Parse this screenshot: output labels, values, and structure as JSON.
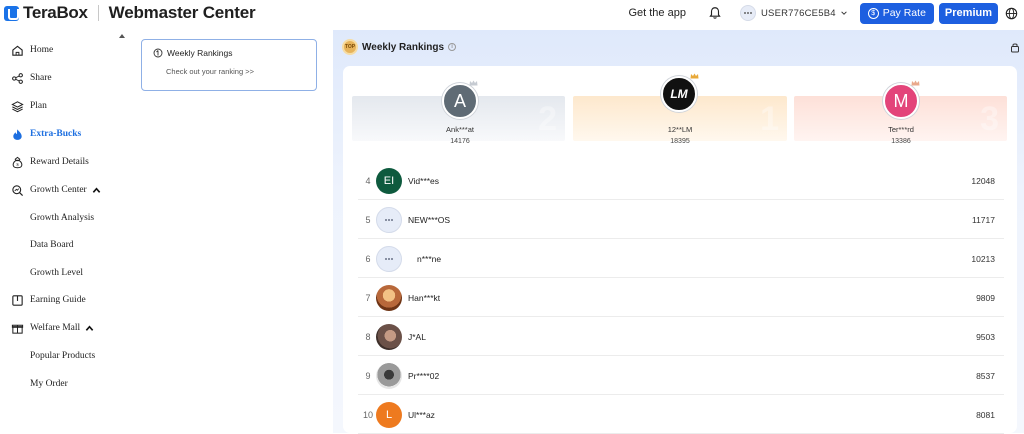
{
  "header": {
    "brand": "TeraBox",
    "title": "Webmaster Center",
    "get_app": "Get the app",
    "user": "USER776CE5B4",
    "pay_rate": "Pay Rate",
    "premium": "Premium"
  },
  "sidebar": {
    "items": [
      {
        "label": "Home",
        "icon": "home-icon"
      },
      {
        "label": "Share",
        "icon": "share-icon"
      },
      {
        "label": "Plan",
        "icon": "layers-icon"
      },
      {
        "label": "Extra-Bucks",
        "icon": "flame-icon",
        "active": true
      },
      {
        "label": "Reward Details",
        "icon": "coin-icon"
      },
      {
        "label": "Growth Center",
        "icon": "growth-icon",
        "expanded": true
      },
      {
        "label": "Growth Analysis",
        "sub": true
      },
      {
        "label": "Data Board",
        "sub": true
      },
      {
        "label": "Growth Level",
        "sub": true
      },
      {
        "label": "Earning Guide",
        "icon": "book-icon"
      },
      {
        "label": "Welfare Mall",
        "icon": "gift-icon",
        "expanded": true
      },
      {
        "label": "Popular Products",
        "sub": true
      },
      {
        "label": "My Order",
        "sub": true
      }
    ]
  },
  "side_card": {
    "title": "Weekly Rankings",
    "desc": "Check out your ranking >>"
  },
  "main": {
    "title": "Weekly Rankings",
    "podium": [
      {
        "place": "2",
        "name": "Ank***at",
        "score": "14176",
        "initial": "A",
        "color": "#5f6b75"
      },
      {
        "place": "1",
        "name": "12**LM",
        "score": "18395",
        "initial": "LM",
        "color": "#111111"
      },
      {
        "place": "3",
        "name": "Ter***rd",
        "score": "13386",
        "initial": "M",
        "color": "#e3447a"
      }
    ],
    "rows": [
      {
        "rank": "4",
        "name": "Vid***es",
        "score": "12048",
        "initial": "EI",
        "color": "#0e5a3e"
      },
      {
        "rank": "5",
        "name": "NEW***OS",
        "score": "11717",
        "initial": "",
        "color": "#e6ecf8"
      },
      {
        "rank": "6",
        "name": "n***ne",
        "score": "10213",
        "initial": "",
        "color": "#e6ecf8"
      },
      {
        "rank": "7",
        "name": "Han***kt",
        "score": "9809",
        "initial": "",
        "color": "#b8683a"
      },
      {
        "rank": "8",
        "name": "J*AL",
        "score": "9503",
        "initial": "",
        "color": "#6b5148"
      },
      {
        "rank": "9",
        "name": "Pr****02",
        "score": "8537",
        "initial": "",
        "color": "#9a9a9a"
      },
      {
        "rank": "10",
        "name": "Ul***az",
        "score": "8081",
        "initial": "L",
        "color": "#ee7a1f"
      }
    ]
  }
}
